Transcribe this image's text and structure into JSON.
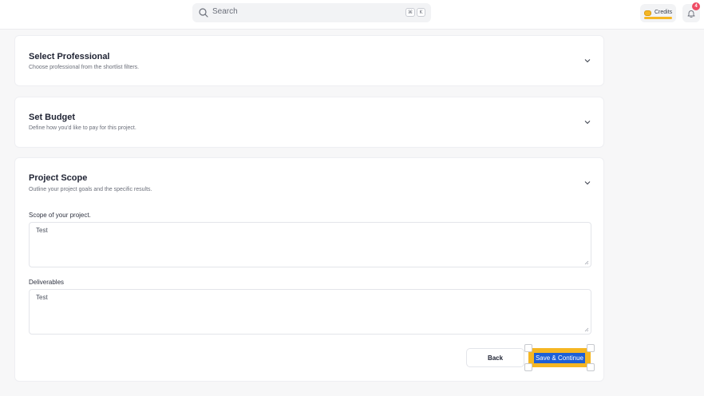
{
  "header": {
    "search_placeholder": "Search",
    "shortcut_cmd": "⌘",
    "shortcut_key": "K",
    "credits_label": "Credits",
    "notification_count": "4"
  },
  "sections": {
    "professional": {
      "title": "Select Professional",
      "subtitle": "Choose professional from the shortlist filters."
    },
    "budget": {
      "title": "Set Budget",
      "subtitle": "Define how you'd like to pay for this project."
    },
    "scope": {
      "title": "Project Scope",
      "subtitle": "Outline your project goals and the specific results.",
      "scope_label": "Scope of your project.",
      "scope_value": "Test",
      "deliverables_label": "Deliverables",
      "deliverables_value": "Test"
    }
  },
  "actions": {
    "back_label": "Back",
    "save_label": "Save & Continue"
  },
  "colors": {
    "accent": "#f5b623",
    "highlight": "#1d5fd6",
    "badge": "#ef4b63"
  }
}
